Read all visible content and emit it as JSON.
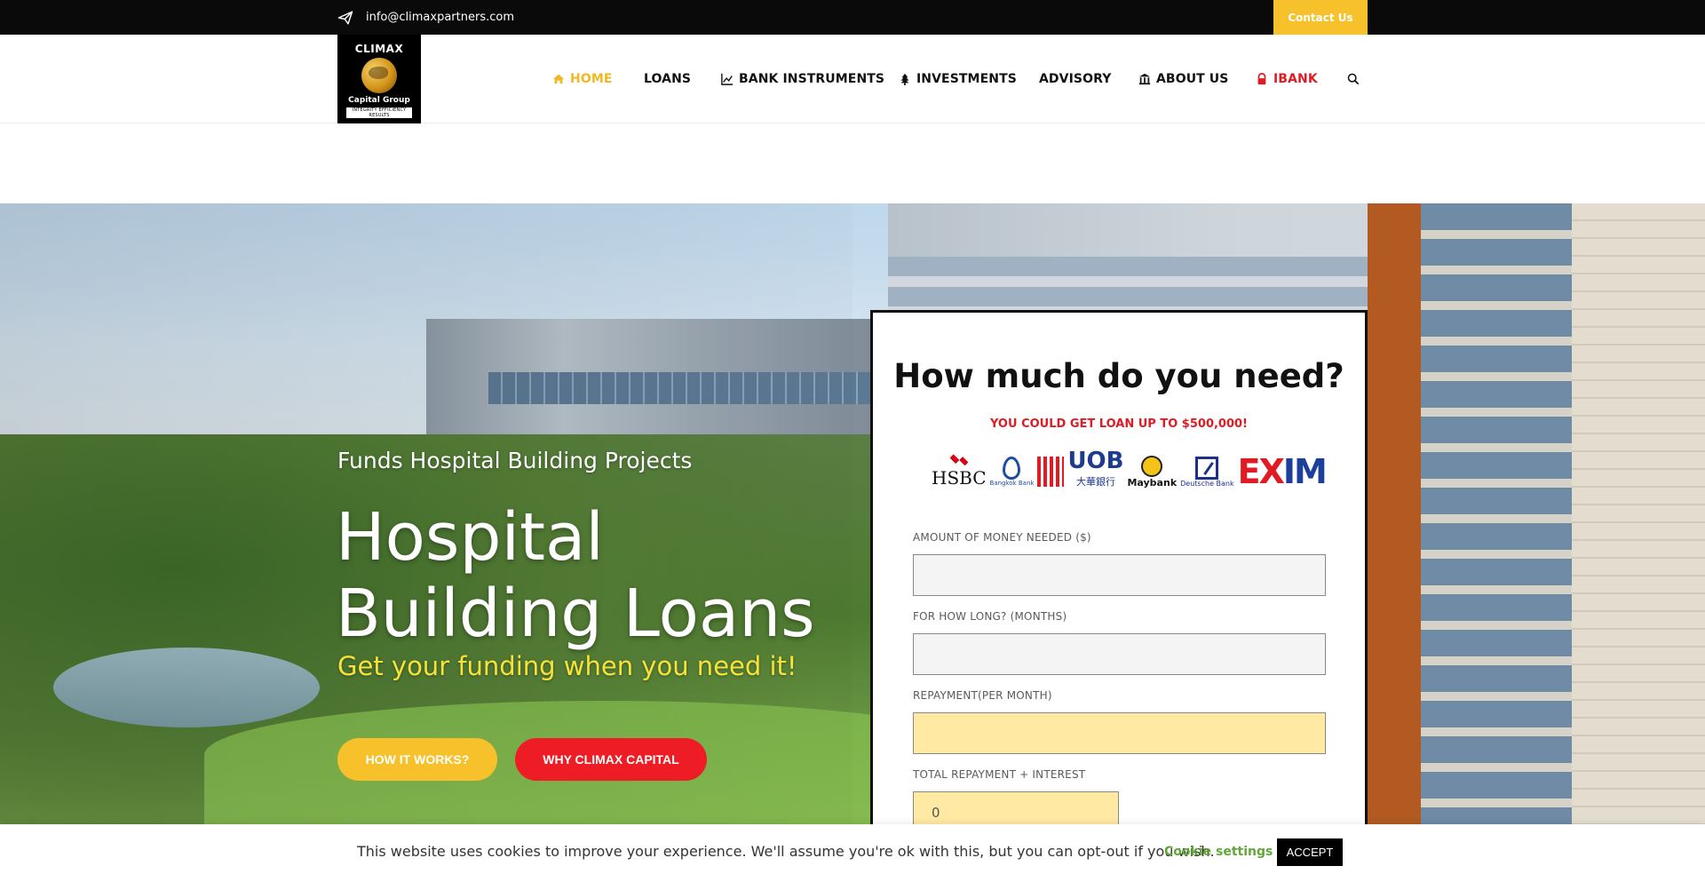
{
  "topbar": {
    "email": "info@climaxpartners.com",
    "contact_label": "Contact Us"
  },
  "logo": {
    "line1": "CLIMAX",
    "line2": "Capital Group",
    "tagline": "INTEGRITY EFFICIENCY RESULTS"
  },
  "nav": {
    "items": [
      {
        "label": "HOME",
        "icon": "home-icon",
        "active": true
      },
      {
        "label": "LOANS"
      },
      {
        "label": "BANK INSTRUMENTS",
        "icon": "chart-icon"
      },
      {
        "label": "INVESTMENTS",
        "icon": "tree-icon"
      },
      {
        "label": "ADVISORY"
      },
      {
        "label": "ABOUT US",
        "icon": "bank-icon"
      },
      {
        "label": "IBANK",
        "icon": "lock-icon"
      }
    ],
    "search_icon": "search-icon"
  },
  "hero": {
    "subtitle": "Funds Hospital Building Projects",
    "title": "Hospital Building Loans",
    "tagline": "Get your funding when you need it!",
    "btn_how": "HOW IT WORKS?",
    "btn_why": "WHY CLIMAX CAPITAL"
  },
  "form": {
    "heading": "How much do you need?",
    "promo": "YOU COULD GET LOAN UP TO $500,000!",
    "banks": {
      "hsbc": "HSBC",
      "bangkok": "Bangkok Bank",
      "uob": "UOB",
      "uob_cn": "大華銀行",
      "maybank": "Maybank",
      "deutsche": "Deutsche Bank",
      "exim_ex": "EX",
      "exim_im": "IM"
    },
    "fields": [
      {
        "label": "AMOUNT OF MONEY NEEDED ($)",
        "value": ""
      },
      {
        "label": "FOR HOW LONG? (MONTHS)",
        "value": ""
      },
      {
        "label": "REPAYMENT(PER MONTH)",
        "value": ""
      },
      {
        "label": "TOTAL REPAYMENT + INTEREST",
        "value": "0"
      }
    ]
  },
  "cookie": {
    "message": "This website uses cookies to improve your experience. We'll assume you're ok with this, but you can opt-out if you wish.",
    "settings_label": "Cookie settings",
    "accept_label": "ACCEPT"
  },
  "colors": {
    "accent_yellow": "#f6c12a",
    "accent_red": "#ee1c25",
    "cookie_green": "#62a737"
  }
}
